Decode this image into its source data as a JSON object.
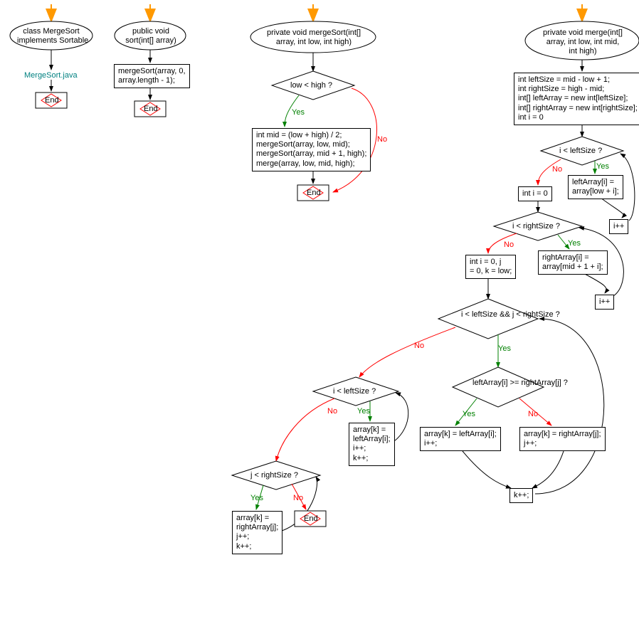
{
  "chart_data": {
    "type": "flowchart",
    "functions": [
      {
        "name": "class MergeSort implements Sortable",
        "file_label": "MergeSort.java",
        "nodes": [
          {
            "id": "cls_start",
            "type": "start",
            "text": "class MergeSort\nimplements Sortable"
          },
          {
            "id": "cls_file",
            "type": "label",
            "text": "MergeSort.java"
          },
          {
            "id": "cls_end",
            "type": "end",
            "text": "End"
          }
        ],
        "edges": [
          {
            "from": "entry",
            "to": "cls_start"
          },
          {
            "from": "cls_start",
            "to": "cls_file"
          },
          {
            "from": "cls_file",
            "to": "cls_end"
          }
        ]
      },
      {
        "name": "public void sort(int[] array)",
        "nodes": [
          {
            "id": "sort_start",
            "type": "start",
            "text": "public void\nsort(int[] array)"
          },
          {
            "id": "sort_body",
            "type": "process",
            "text": "mergeSort(array, 0,\narray.length - 1);"
          },
          {
            "id": "sort_end",
            "type": "end",
            "text": "End"
          }
        ],
        "edges": [
          {
            "from": "entry",
            "to": "sort_start"
          },
          {
            "from": "sort_start",
            "to": "sort_body"
          },
          {
            "from": "sort_body",
            "to": "sort_end"
          }
        ]
      },
      {
        "name": "private void mergeSort(int[] array, int low, int high)",
        "nodes": [
          {
            "id": "ms_start",
            "type": "start",
            "text": "private void mergeSort(int[]\narray, int low, int high)"
          },
          {
            "id": "ms_cond",
            "type": "decision",
            "text": "low < high ?"
          },
          {
            "id": "ms_body",
            "type": "process",
            "text": "int mid = (low + high) / 2;\nmergeSort(array, low, mid);\nmergeSort(array, mid + 1, high);\nmerge(array, low, mid, high);"
          },
          {
            "id": "ms_end",
            "type": "end",
            "text": "End"
          }
        ],
        "edges": [
          {
            "from": "entry",
            "to": "ms_start"
          },
          {
            "from": "ms_start",
            "to": "ms_cond"
          },
          {
            "from": "ms_cond",
            "to": "ms_body",
            "label": "Yes",
            "color": "green"
          },
          {
            "from": "ms_cond",
            "to": "ms_end",
            "label": "No",
            "color": "red"
          },
          {
            "from": "ms_body",
            "to": "ms_end"
          }
        ]
      },
      {
        "name": "private void merge(int[] array, int low, int mid, int high)",
        "nodes": [
          {
            "id": "m_start",
            "type": "start",
            "text": "private void merge(int[]\narray, int low, int mid,\nint high)"
          },
          {
            "id": "m_init",
            "type": "process",
            "text": "int leftSize = mid - low + 1;\nint rightSize = high - mid;\nint[] leftArray = new int[leftSize];\nint[] rightArray = new int[rightSize];\nint i = 0"
          },
          {
            "id": "m_c1",
            "type": "decision",
            "text": "i < leftSize ?"
          },
          {
            "id": "m_c1yes",
            "type": "process",
            "text": "leftArray[i] =\narray[low + i];"
          },
          {
            "id": "m_c1inc",
            "type": "process",
            "text": "i++"
          },
          {
            "id": "m_c1no",
            "type": "process",
            "text": "int i = 0"
          },
          {
            "id": "m_c2",
            "type": "decision",
            "text": "i < rightSize ?"
          },
          {
            "id": "m_c2yes",
            "type": "process",
            "text": "rightArray[i] =\narray[mid + 1 + i];"
          },
          {
            "id": "m_c2inc",
            "type": "process",
            "text": "i++"
          },
          {
            "id": "m_c2no",
            "type": "process",
            "text": "int i = 0, j\n= 0, k = low;"
          },
          {
            "id": "m_c3",
            "type": "decision",
            "text": "i < leftSize &&\nj < rightSize ?"
          },
          {
            "id": "m_c4",
            "type": "decision",
            "text": "leftArray[i] >=\nrightArray[j] ?"
          },
          {
            "id": "m_c4yes",
            "type": "process",
            "text": "array[k] = leftArray[i];\ni++;"
          },
          {
            "id": "m_c4no",
            "type": "process",
            "text": "array[k] = rightArray[j];\nj++;"
          },
          {
            "id": "m_kpp",
            "type": "process",
            "text": "k++;"
          },
          {
            "id": "m_c5",
            "type": "decision",
            "text": "i < leftSize ?"
          },
          {
            "id": "m_c5yes",
            "type": "process",
            "text": "array[k] =\nleftArray[i];\ni++;\nk++;"
          },
          {
            "id": "m_c6",
            "type": "decision",
            "text": "j < rightSize ?"
          },
          {
            "id": "m_c6yes",
            "type": "process",
            "text": "array[k] =\nrightArray[j];\nj++;\nk++;"
          },
          {
            "id": "m_end",
            "type": "end",
            "text": "End"
          }
        ],
        "edges": [
          {
            "from": "entry",
            "to": "m_start"
          },
          {
            "from": "m_start",
            "to": "m_init"
          },
          {
            "from": "m_init",
            "to": "m_c1"
          },
          {
            "from": "m_c1",
            "to": "m_c1yes",
            "label": "Yes",
            "color": "green"
          },
          {
            "from": "m_c1yes",
            "to": "m_c1inc"
          },
          {
            "from": "m_c1inc",
            "to": "m_c1"
          },
          {
            "from": "m_c1",
            "to": "m_c1no",
            "label": "No",
            "color": "red"
          },
          {
            "from": "m_c1no",
            "to": "m_c2"
          },
          {
            "from": "m_c2",
            "to": "m_c2yes",
            "label": "Yes",
            "color": "green"
          },
          {
            "from": "m_c2yes",
            "to": "m_c2inc"
          },
          {
            "from": "m_c2inc",
            "to": "m_c2"
          },
          {
            "from": "m_c2",
            "to": "m_c2no",
            "label": "No",
            "color": "red"
          },
          {
            "from": "m_c2no",
            "to": "m_c3"
          },
          {
            "from": "m_c3",
            "to": "m_c4",
            "label": "Yes",
            "color": "green"
          },
          {
            "from": "m_c4",
            "to": "m_c4yes",
            "label": "Yes",
            "color": "green"
          },
          {
            "from": "m_c4",
            "to": "m_c4no",
            "label": "No",
            "color": "red"
          },
          {
            "from": "m_c4yes",
            "to": "m_kpp"
          },
          {
            "from": "m_c4no",
            "to": "m_kpp"
          },
          {
            "from": "m_kpp",
            "to": "m_c3"
          },
          {
            "from": "m_c3",
            "to": "m_c5",
            "label": "No",
            "color": "red"
          },
          {
            "from": "m_c5",
            "to": "m_c5yes",
            "label": "Yes",
            "color": "green"
          },
          {
            "from": "m_c5yes",
            "to": "m_c5"
          },
          {
            "from": "m_c5",
            "to": "m_c6",
            "label": "No",
            "color": "red"
          },
          {
            "from": "m_c6",
            "to": "m_c6yes",
            "label": "Yes",
            "color": "green"
          },
          {
            "from": "m_c6yes",
            "to": "m_c6"
          },
          {
            "from": "m_c6",
            "to": "m_end",
            "label": "No",
            "color": "red"
          }
        ]
      }
    ]
  },
  "labels": {
    "yes": "Yes",
    "no": "No",
    "end": "End"
  },
  "n": {
    "cls_start": "class MergeSort\nimplements Sortable",
    "cls_file": "MergeSort.java",
    "sort_start": "public void\nsort(int[] array)",
    "sort_body": "mergeSort(array, 0,\narray.length - 1);",
    "ms_start": "private void mergeSort(int[]\narray, int low, int high)",
    "ms_cond": "low < high ?",
    "ms_body": "int mid = (low + high) / 2;\nmergeSort(array, low, mid);\nmergeSort(array, mid + 1, high);\nmerge(array, low, mid, high);",
    "m_start": "private void merge(int[]\narray, int low, int mid,\nint high)",
    "m_init": "int leftSize = mid - low + 1;\nint rightSize = high - mid;\nint[] leftArray = new int[leftSize];\nint[] rightArray = new int[rightSize];\nint i = 0",
    "m_c1": "i < leftSize ?",
    "m_c1yes": "leftArray[i] =\narray[low + i];",
    "m_c1inc": "i++",
    "m_c1no": "int i = 0",
    "m_c2": "i < rightSize ?",
    "m_c2yes": "rightArray[i] =\narray[mid + 1 + i];",
    "m_c2inc": "i++",
    "m_c2no": "int i = 0, j\n= 0, k = low;",
    "m_c3": "i < leftSize &&\nj < rightSize ?",
    "m_c4": "leftArray[i] >=\nrightArray[j] ?",
    "m_c4yes": "array[k] = leftArray[i];\ni++;",
    "m_c4no": "array[k] = rightArray[j];\nj++;",
    "m_kpp": "k++;",
    "m_c5": "i < leftSize ?",
    "m_c5yes": "array[k] =\nleftArray[i];\ni++;\nk++;",
    "m_c6": "j < rightSize ?",
    "m_c6yes": "array[k] =\nrightArray[j];\nj++;\nk++;"
  }
}
